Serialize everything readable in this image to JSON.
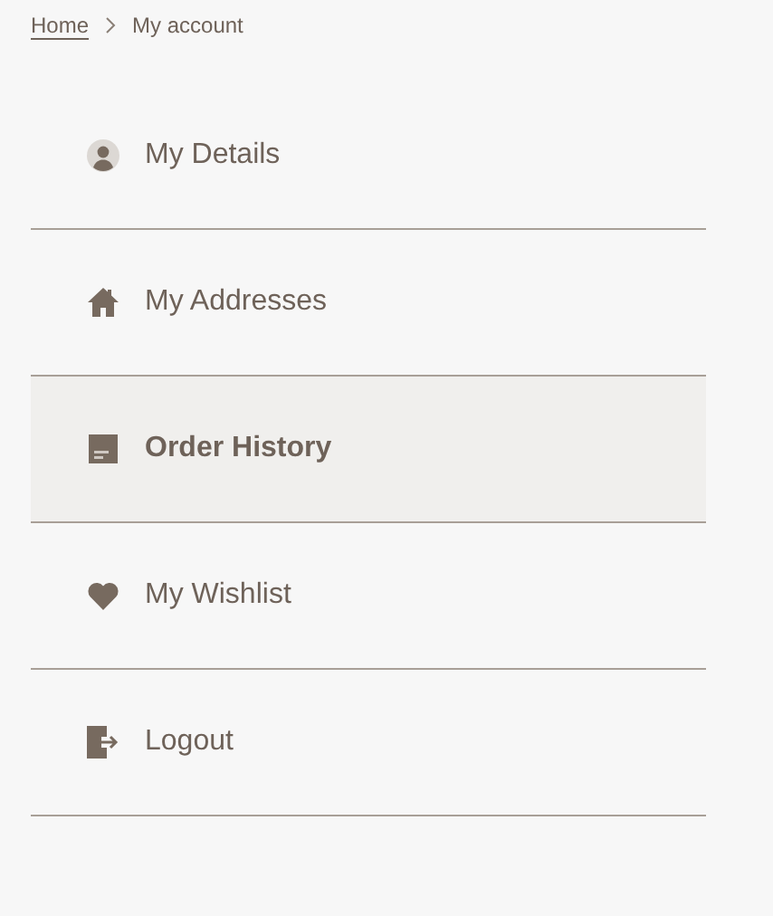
{
  "breadcrumb": [
    {
      "label": "Home",
      "link": true
    },
    {
      "label": "My account",
      "link": false
    }
  ],
  "menu": [
    {
      "label": "My Details",
      "kind": "person",
      "selected": false
    },
    {
      "label": "My Addresses",
      "kind": "house",
      "selected": false
    },
    {
      "label": "Order History",
      "kind": "floppy",
      "selected": true
    },
    {
      "label": "My Wishlist",
      "kind": "heart",
      "selected": false
    },
    {
      "label": "Logout",
      "kind": "logout",
      "selected": false
    }
  ]
}
